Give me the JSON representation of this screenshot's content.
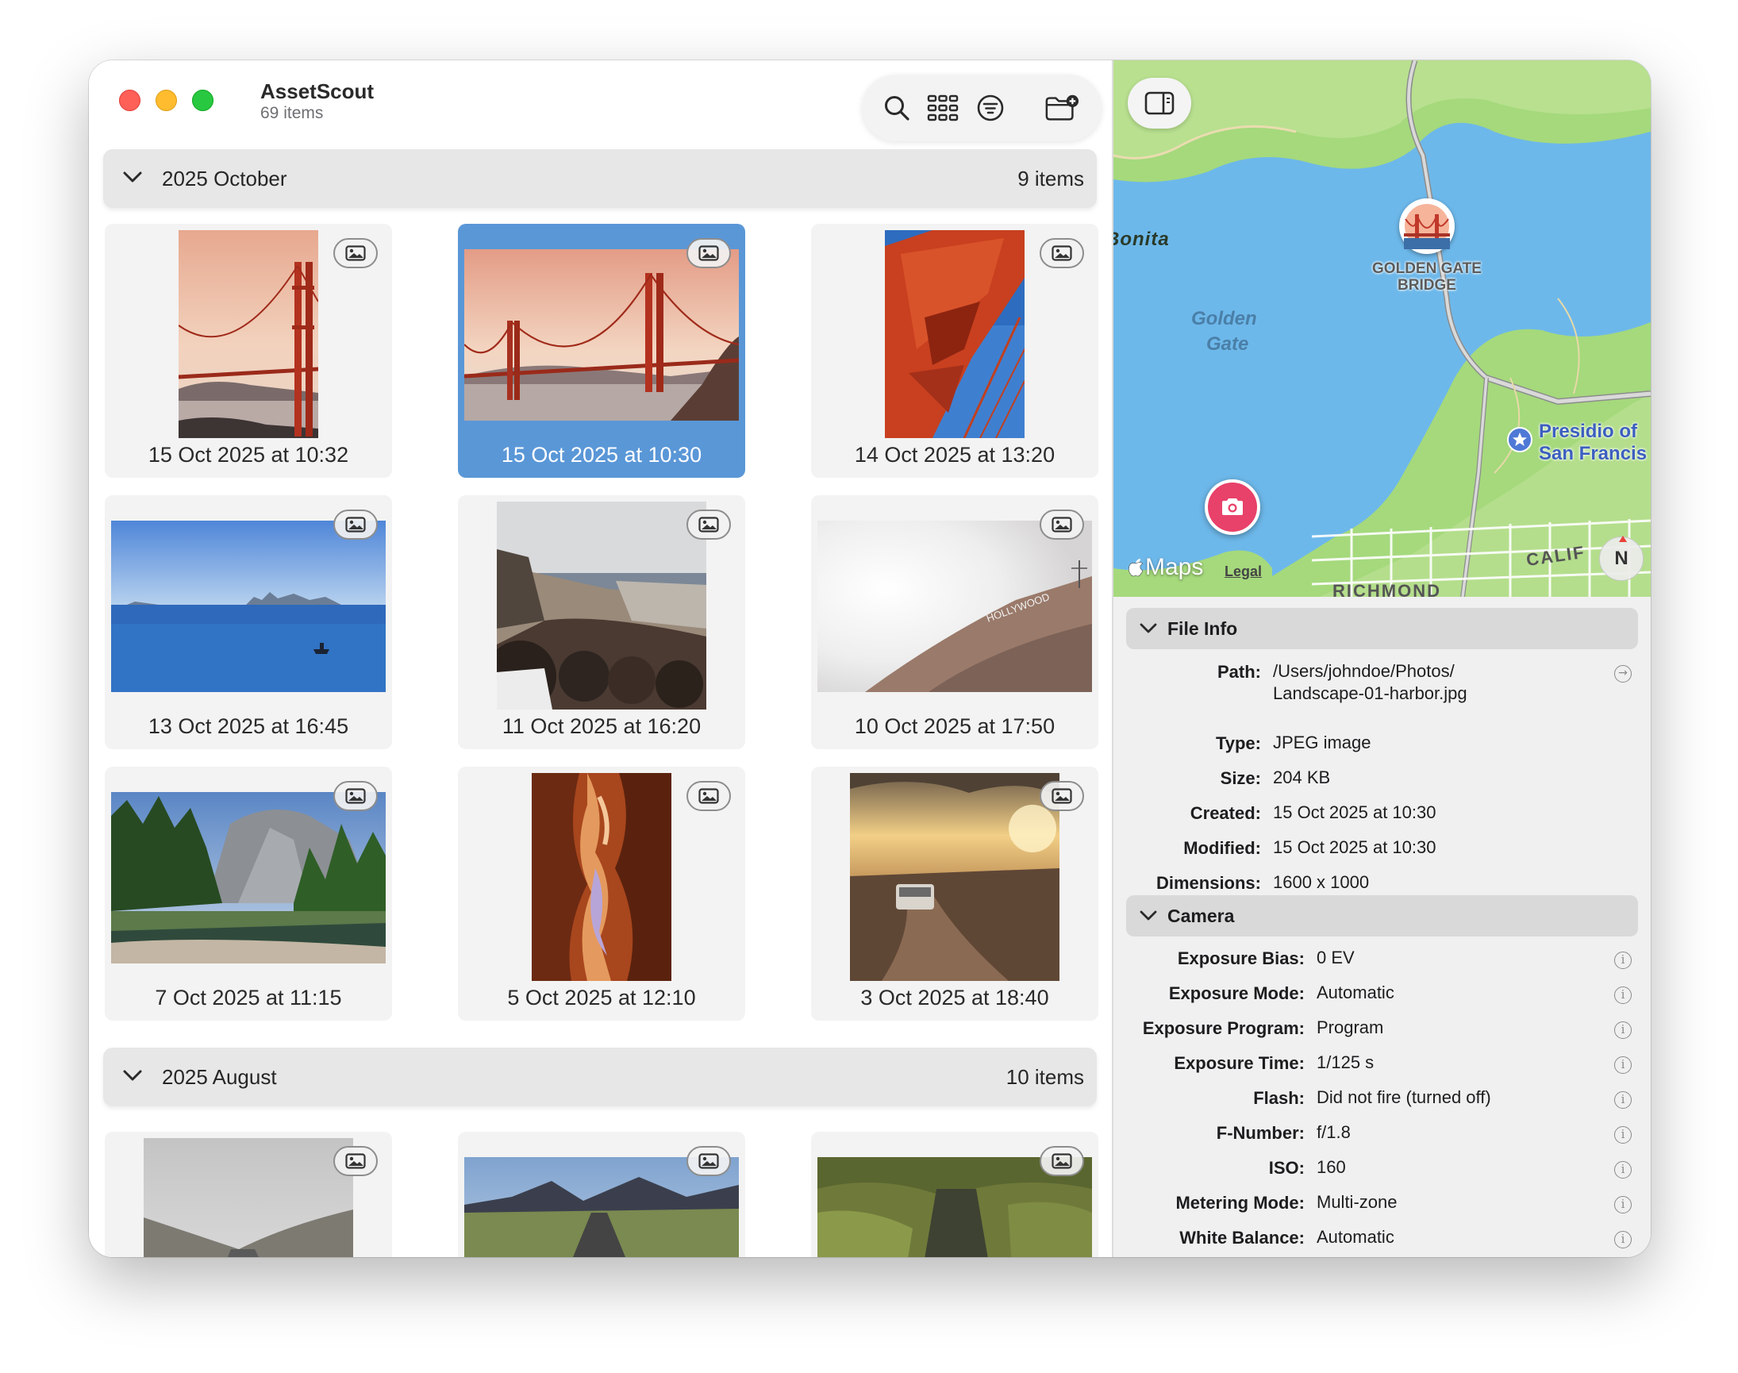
{
  "window": {
    "app_title": "AssetScout",
    "item_count": "69 items"
  },
  "toolbar": {
    "search_icon": "search-icon",
    "grid_icon": "grid-view-icon",
    "filter_icon": "filter-icon",
    "new_folder_icon": "new-folder-icon"
  },
  "sections": [
    {
      "title": "2025 October",
      "count": "9 items",
      "items": [
        {
          "label": "15 Oct 2025 at 10:32"
        },
        {
          "label": "15 Oct 2025 at 10:30",
          "selected": true
        },
        {
          "label": "14 Oct 2025 at 13:20"
        },
        {
          "label": "13 Oct 2025 at 16:45"
        },
        {
          "label": "11 Oct 2025 at 16:20"
        },
        {
          "label": "10 Oct 2025 at 17:50"
        },
        {
          "label": "7 Oct 2025 at 11:15"
        },
        {
          "label": "5 Oct 2025 at 12:10"
        },
        {
          "label": "3 Oct 2025 at 18:40"
        }
      ]
    },
    {
      "title": "2025 August",
      "count": "10 items"
    }
  ],
  "map": {
    "place_bonita": "Bonita",
    "place_golden": "Golden",
    "place_gate": "Gate",
    "landmark_line1": "GOLDEN GATE",
    "landmark_line2": "BRIDGE",
    "presidio_line1": "Presidio of",
    "presidio_line2": "San Francis",
    "richmond": "RICHMOND",
    "calif": "CALIF",
    "compass": "N",
    "maps_logo": "Maps",
    "legal": "Legal"
  },
  "file_info": {
    "title": "File Info",
    "path_label": "Path:",
    "path_line1": "/Users/johndoe/Photos/",
    "path_line2": "Landscape-01-harbor.jpg",
    "type_label": "Type:",
    "type_value": "JPEG image",
    "size_label": "Size:",
    "size_value": "204 KB",
    "created_label": "Created:",
    "created_value": "15 Oct 2025 at 10:30",
    "modified_label": "Modified:",
    "modified_value": "15 Oct 2025 at 10:30",
    "dimensions_label": "Dimensions:",
    "dimensions_value": "1600 x 1000"
  },
  "camera": {
    "title": "Camera",
    "rows": [
      {
        "label": "Exposure Bias:",
        "value": "0 EV"
      },
      {
        "label": "Exposure Mode:",
        "value": "Automatic"
      },
      {
        "label": "Exposure Program:",
        "value": "Program"
      },
      {
        "label": "Exposure Time:",
        "value": "1/125 s"
      },
      {
        "label": "Flash:",
        "value": "Did not fire (turned off)"
      },
      {
        "label": "F-Number:",
        "value": "f/1.8"
      },
      {
        "label": "ISO:",
        "value": "160"
      },
      {
        "label": "Metering Mode:",
        "value": "Multi-zone"
      },
      {
        "label": "White Balance:",
        "value": "Automatic"
      }
    ]
  },
  "colors": {
    "selection": "#5a97d7",
    "close": "#fe5f57",
    "minimize": "#febc2e",
    "maximize": "#28c840",
    "map_water": "#6db8ea",
    "map_land": "#a5d97c",
    "map_pin": "#e8416a"
  }
}
